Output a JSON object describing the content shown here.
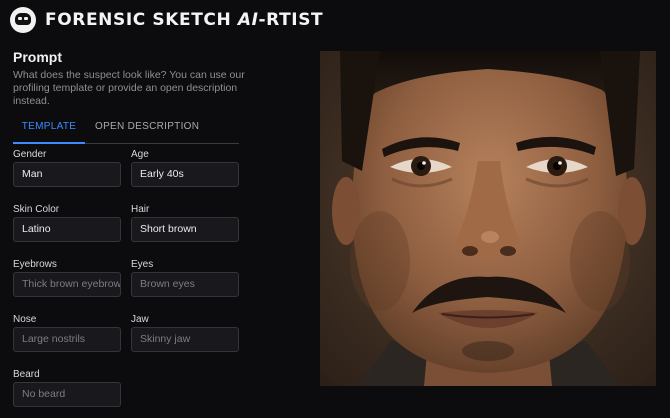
{
  "app": {
    "title_prefix": "FORENSIC SKETCH ",
    "title_ai": "AI",
    "title_suffix": "-RTIST"
  },
  "prompt": {
    "title": "Prompt",
    "description": "What does the suspect look like? You can use our profiling template or provide an open description instead."
  },
  "tabs": [
    {
      "label": "TEMPLATE",
      "active": true
    },
    {
      "label": "OPEN DESCRIPTION",
      "active": false
    }
  ],
  "fields": {
    "gender": {
      "label": "Gender",
      "value": "Man"
    },
    "age": {
      "label": "Age",
      "value": "Early 40s"
    },
    "skin_color": {
      "label": "Skin Color",
      "value": "Latino"
    },
    "hair": {
      "label": "Hair",
      "value": "Short brown"
    },
    "eyebrows": {
      "label": "Eyebrows",
      "placeholder": "Thick brown eyebrows"
    },
    "eyes": {
      "label": "Eyes",
      "placeholder": "Brown eyes"
    },
    "nose": {
      "label": "Nose",
      "placeholder": "Large nostrils"
    },
    "jaw": {
      "label": "Jaw",
      "placeholder": "Skinny jaw"
    },
    "beard": {
      "label": "Beard",
      "placeholder": "No beard"
    }
  },
  "colors": {
    "accent": "#3d8bff",
    "background": "#0c0c0e",
    "input_bg": "#19191d"
  }
}
